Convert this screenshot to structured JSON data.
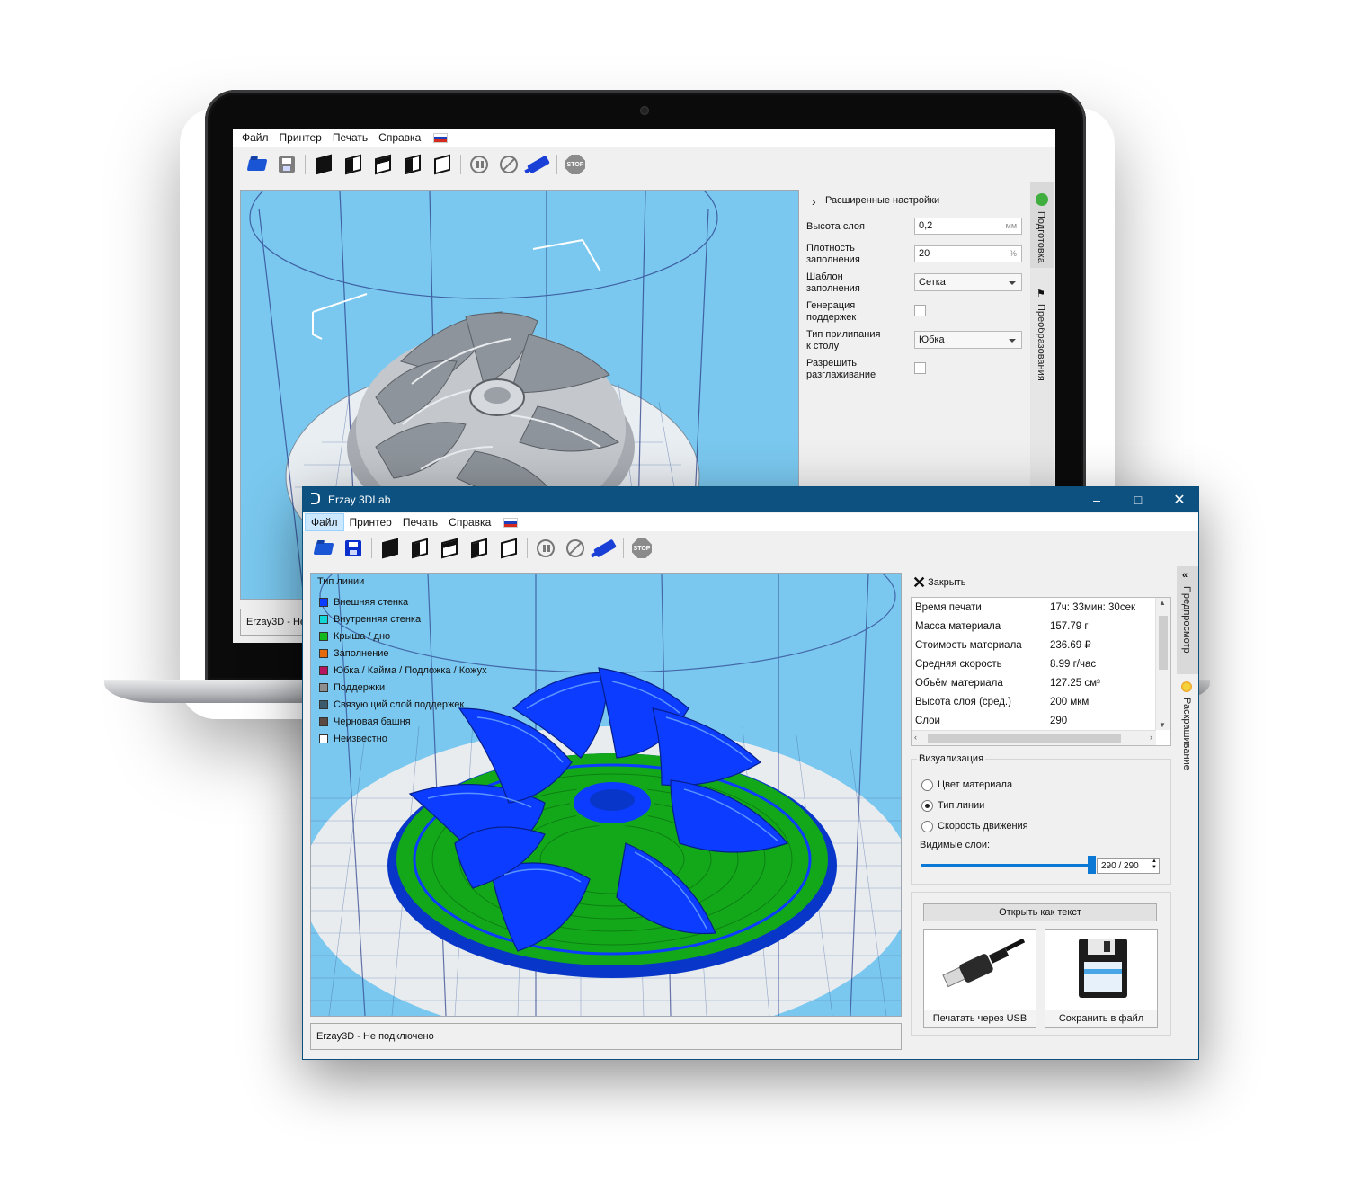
{
  "laptop": {
    "menu": [
      "Файл",
      "Принтер",
      "Печать",
      "Справка"
    ],
    "panel": {
      "advanced_settings": "Расширенные настройки",
      "layer_height_label": "Высота слоя",
      "layer_height_value": "0,2",
      "layer_height_unit": "мм",
      "infill_density_label": "Плотность\nзаполнения",
      "infill_density_value": "20",
      "infill_density_unit": "%",
      "infill_pattern_label": "Шаблон\nзаполнения",
      "infill_pattern_value": "Сетка",
      "support_label": "Генерация\nподдержек",
      "adhesion_label": "Тип прилипания\nк столу",
      "adhesion_value": "Юбка",
      "ironing_label": "Разрешить\nразглаживание"
    },
    "tabs": {
      "prepare": "Подготовка",
      "transform": "Преобразования"
    },
    "status": "Erzay3D - Не"
  },
  "window": {
    "title": "Erzay 3DLab",
    "menu": [
      "Файл",
      "Принтер",
      "Печать",
      "Справка"
    ],
    "legend": {
      "title": "Тип линии",
      "items": [
        {
          "label": "Внешняя стенка",
          "color": "#0b3cff"
        },
        {
          "label": "Внутренняя стенка",
          "color": "#12d6d6"
        },
        {
          "label": "Крыша / дно",
          "color": "#13b81a"
        },
        {
          "label": "Заполнение",
          "color": "#e36b0c"
        },
        {
          "label": "Юбка / Кайма / Подложка / Кожух",
          "color": "#b5155e"
        },
        {
          "label": "Поддержки",
          "color": "#8e8e8e"
        },
        {
          "label": "Связующий слой поддержек",
          "color": "#3b5a6e"
        },
        {
          "label": "Черновая башня",
          "color": "#5b4a44"
        },
        {
          "label": "Неизвестно",
          "color": "#ffffff"
        }
      ]
    },
    "close_label": "Закрыть",
    "stats": [
      {
        "label": "Время печати",
        "value": "17ч: 33мин: 30сек"
      },
      {
        "label": "Масса материала",
        "value": "157.79 г"
      },
      {
        "label": "Стоимость материала",
        "value": "236.69 ₽"
      },
      {
        "label": "Средняя скорость",
        "value": "8.99 г/час"
      },
      {
        "label": "Объём материала",
        "value": "127.25 см³"
      },
      {
        "label": "Высота слоя (сред.)",
        "value": "200 мкм"
      },
      {
        "label": "Слои",
        "value": "290"
      }
    ],
    "visualization": {
      "title": "Визуализация",
      "options": [
        "Цвет материала",
        "Тип линии",
        "Скорость движения"
      ],
      "selected": 1,
      "visible_layers_label": "Видимые слои:",
      "layers_value": "290 / 290",
      "layers_fraction": 1.0
    },
    "open_as_text": "Открыть как текст",
    "print_usb": "Печатать через USB",
    "save_file": "Сохранить в файл",
    "tabs": {
      "preview": "Предпросмотр",
      "slicing": "Раскрашивание"
    },
    "status": "Erzay3D - Не подключено"
  }
}
